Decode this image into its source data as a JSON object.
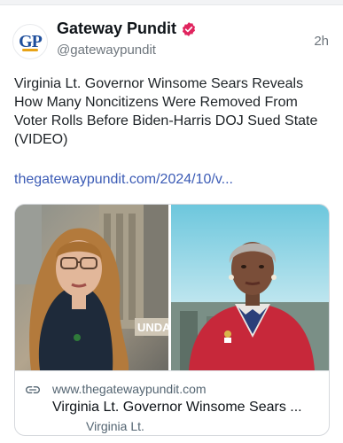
{
  "author": {
    "avatar_text": "GP",
    "name": "Gateway Pundit",
    "handle": "@gatewaypundit",
    "time": "2h"
  },
  "post": {
    "text": "Virginia Lt. Governor Winsome Sears Reveals How Many Noncitizens Were Removed From Voter Rolls Before Biden-Harris DOJ Sued State (VIDEO)",
    "link": "thegatewaypundit.com/2024/10/v..."
  },
  "card": {
    "domain": "www.thegatewaypundit.com",
    "title": "Virginia Lt. Governor Winsome Sears ...",
    "description": "Virginia Lt.",
    "image_overlay_text": "UNDAY"
  },
  "icons": {
    "verified": "verified-badge-icon",
    "link": "link-icon"
  },
  "colors": {
    "verified_badge": "#e0245e",
    "link_text": "#3b5bb5",
    "muted_text": "#6e767d"
  }
}
